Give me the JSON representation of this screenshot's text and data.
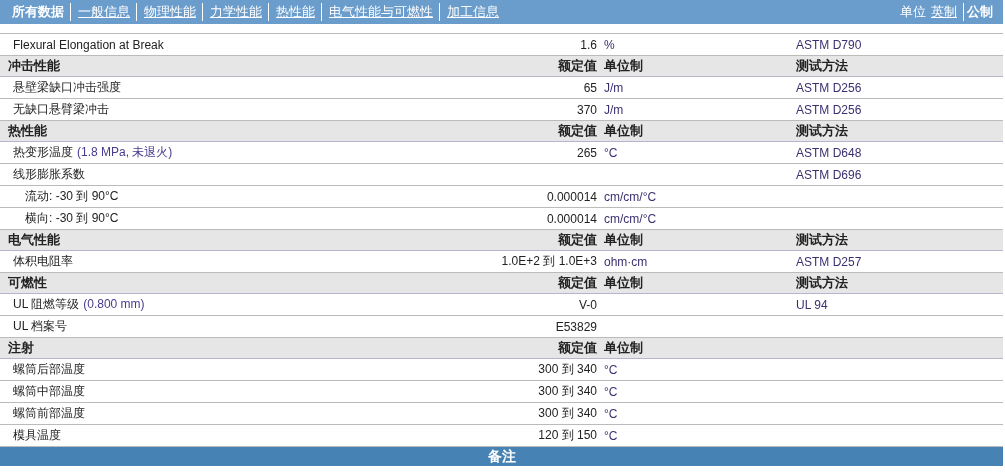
{
  "nav": {
    "tabs": [
      {
        "label": "所有数据",
        "selected": true
      },
      {
        "label": "一般信息",
        "selected": false
      },
      {
        "label": "物理性能",
        "selected": false
      },
      {
        "label": "力学性能",
        "selected": false
      },
      {
        "label": "热性能",
        "selected": false
      },
      {
        "label": "电气性能与可燃性",
        "selected": false
      },
      {
        "label": "加工信息",
        "selected": false
      }
    ],
    "units_label": "单位",
    "units": [
      {
        "label": "英制",
        "selected": false
      },
      {
        "label": "公制",
        "selected": true
      }
    ]
  },
  "sections": [
    {
      "rows": [
        {
          "label": "Flexural Elongation at Break",
          "value": "1.6",
          "unit": "%",
          "method": "ASTM D790"
        }
      ]
    },
    {
      "title": "冲击性能",
      "value_header": "额定值",
      "unit_header": "单位制",
      "method_header": "测试方法",
      "rows": [
        {
          "label": "悬壁梁缺口冲击强度",
          "value": "65",
          "unit": "J/m",
          "method": "ASTM D256"
        },
        {
          "label": "无缺口悬臂梁冲击",
          "value": "370",
          "unit": "J/m",
          "method": "ASTM D256"
        }
      ]
    },
    {
      "title": "热性能",
      "value_header": "额定值",
      "unit_header": "单位制",
      "method_header": "测试方法",
      "rows": [
        {
          "label": "热变形温度",
          "note": "(1.8 MPa, 未退火)",
          "value": "265",
          "unit": "°C",
          "method": "ASTM D648"
        },
        {
          "label": "线形膨胀系数",
          "method": "ASTM D696",
          "children": [
            {
              "label": "流动: -30 到  90°C",
              "value": "0.000014",
              "unit": "cm/cm/°C"
            },
            {
              "label": "横向: -30 到  90°C",
              "value": "0.000014",
              "unit": "cm/cm/°C"
            }
          ]
        }
      ]
    },
    {
      "title": "电气性能",
      "value_header": "额定值",
      "unit_header": "单位制",
      "method_header": "测试方法",
      "rows": [
        {
          "label": "体积电阻率",
          "value": "1.0E+2 到  1.0E+3",
          "unit": "ohm·cm",
          "method": "ASTM D257"
        }
      ]
    },
    {
      "title": "可燃性",
      "value_header": "额定值",
      "unit_header": "单位制",
      "method_header": "测试方法",
      "rows": [
        {
          "label": "UL 阻燃等级",
          "note": "(0.800 mm)",
          "value": "V-0",
          "method": "UL 94"
        },
        {
          "label": "UL 档案号",
          "value": "E53829"
        }
      ]
    },
    {
      "title": "注射",
      "value_header": "额定值",
      "unit_header": "单位制",
      "rows": [
        {
          "label": "螺筒后部温度",
          "value": "300 到  340",
          "unit": "°C"
        },
        {
          "label": "螺筒中部温度",
          "value": "300 到  340",
          "unit": "°C"
        },
        {
          "label": "螺筒前部温度",
          "value": "300 到  340",
          "unit": "°C"
        },
        {
          "label": "模具温度",
          "value": "120 到  150",
          "unit": "°C"
        }
      ]
    }
  ],
  "footer": {
    "title": "备注"
  }
}
